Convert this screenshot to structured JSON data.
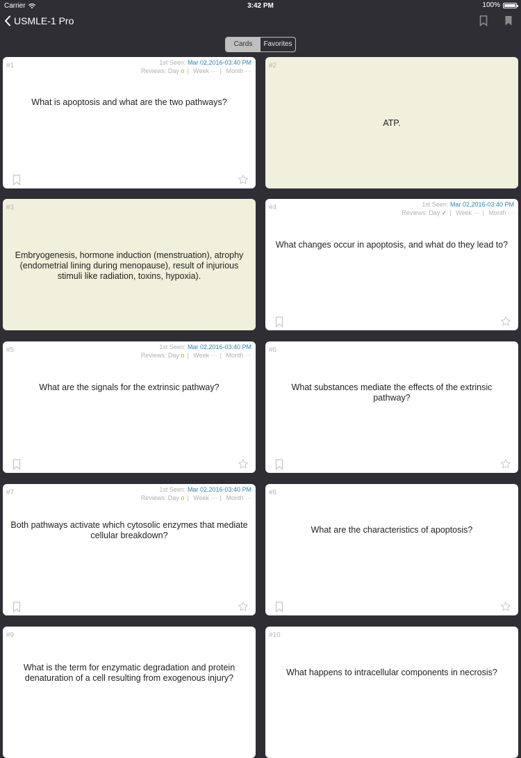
{
  "status_bar": {
    "carrier": "Carrier",
    "time": "3:42 PM",
    "battery": "100%"
  },
  "nav": {
    "back_label": "USMLE-1 Pro"
  },
  "segments": {
    "cards": "Cards",
    "favorites": "Favorites"
  },
  "meta_labels": {
    "first_seen": "1st Seen:",
    "reviews": "Reviews:",
    "day": "Day",
    "week": "Week",
    "month": "Month",
    "dots": "···"
  },
  "cards": [
    {
      "num": "#1",
      "text": "What is apoptosis and what are the two pathways?",
      "first_seen": "Mar 02,2016-03:40 PM",
      "day_mark": "o"
    },
    {
      "num": "#2",
      "text": "ATP."
    },
    {
      "num": "#3",
      "text": "Embryogenesis, hormone induction (menstruation), atrophy (endometrial lining during menopause), result of injurious stimuli like radiation, toxins, hypoxia)."
    },
    {
      "num": "#4",
      "text": "What changes occur in apoptosis, and what do they lead to?",
      "first_seen": "Mar 02,2016-03:40 PM",
      "day_mark": "✓"
    },
    {
      "num": "#5",
      "text": "What are the signals for the extrinsic pathway?",
      "first_seen": "Mar 02,2016-03:40 PM",
      "day_mark": "o"
    },
    {
      "num": "#6",
      "text": "What substances mediate the effects of the extrinsic pathway?"
    },
    {
      "num": "#7",
      "text": "Both pathways activate which cytosolic enzymes that mediate cellular breakdown?",
      "first_seen": "Mar 02,2016-03:40 PM",
      "day_mark": "o"
    },
    {
      "num": "#8",
      "text": "What are the characteristics of apoptosis?"
    },
    {
      "num": "#9",
      "text": "What is the term for enzymatic degradation and protein denaturation of a cell resulting from exogenous injury?"
    },
    {
      "num": "#10",
      "text": "What happens to intracellular components in necrosis?"
    }
  ]
}
